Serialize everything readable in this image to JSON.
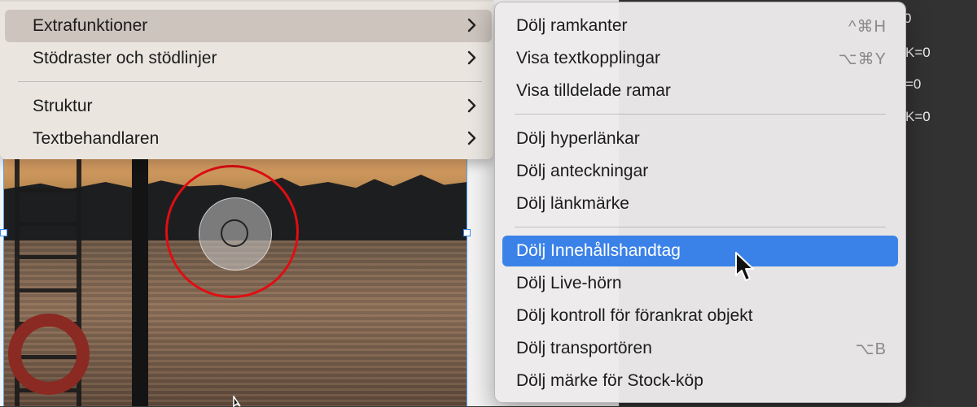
{
  "parent_menu": {
    "items": [
      {
        "label": "Extrafunktioner",
        "has_submenu": true,
        "active": true
      },
      {
        "label": "Stödraster och stödlinjer",
        "has_submenu": true,
        "active": false
      },
      {
        "label": "Struktur",
        "has_submenu": true,
        "active": false
      },
      {
        "label": "Textbehandlaren",
        "has_submenu": true,
        "active": false
      }
    ]
  },
  "submenu": {
    "groups": [
      [
        {
          "label": "Dölj ramkanter",
          "shortcut": "^⌘H"
        },
        {
          "label": "Visa textkopplingar",
          "shortcut": "⌥⌘Y"
        },
        {
          "label": "Visa tilldelade ramar",
          "shortcut": ""
        }
      ],
      [
        {
          "label": "Dölj hyperlänkar",
          "shortcut": ""
        },
        {
          "label": "Dölj anteckningar",
          "shortcut": ""
        },
        {
          "label": "Dölj länkmärke",
          "shortcut": ""
        }
      ],
      [
        {
          "label": "Dölj Innehållshandtag",
          "shortcut": "",
          "selected": true
        },
        {
          "label": "Dölj Live-hörn",
          "shortcut": ""
        },
        {
          "label": "Dölj kontroll för förankrat objekt",
          "shortcut": ""
        },
        {
          "label": "Dölj transportören",
          "shortcut": "⌥B"
        },
        {
          "label": "Dölj märke för Stock-köp",
          "shortcut": ""
        }
      ]
    ]
  },
  "right_panel": {
    "values": [
      "0",
      "K=0",
      "=0",
      "K=0"
    ]
  },
  "colors": {
    "selection": "#3b82e8",
    "highlight_circle": "#e00d12"
  }
}
